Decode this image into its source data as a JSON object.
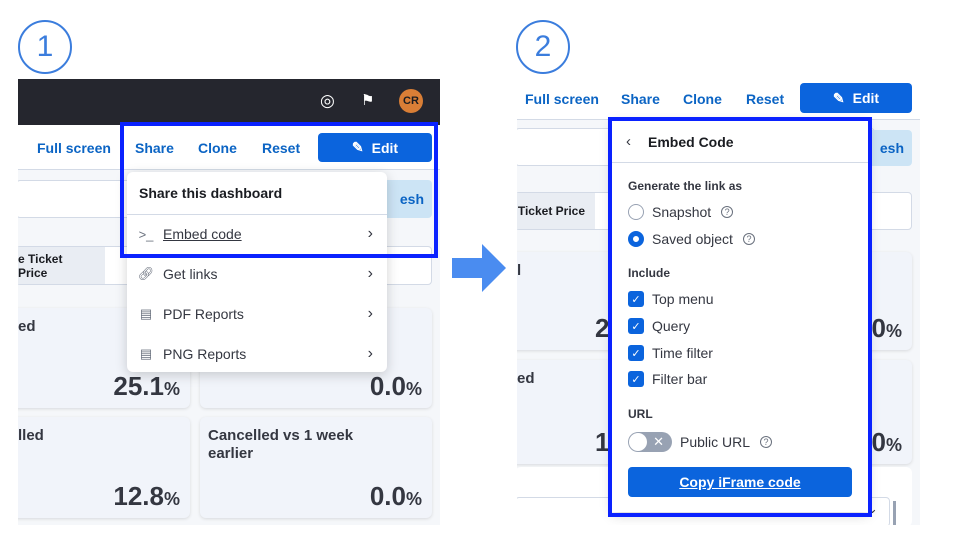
{
  "steps": [
    "1",
    "2"
  ],
  "header": {
    "avatar": "CR",
    "avatar_color": "#d97e36",
    "icons": [
      "help-lifebuoy-icon",
      "news-party-icon"
    ]
  },
  "toolbar": {
    "full_screen": "Full screen",
    "share": "Share",
    "clone": "Clone",
    "reset": "Reset",
    "edit": "Edit"
  },
  "query": {
    "refresh_partial": "esh"
  },
  "filters": {
    "left_pill": "e Ticket Price",
    "right_pill": "Ticket Price"
  },
  "cards_left": [
    {
      "title": "ed",
      "value": "25.1",
      "unit": "%"
    },
    {
      "title": "",
      "value": "0.0",
      "unit": "%"
    },
    {
      "title": "lled",
      "value": "12.8",
      "unit": "%"
    },
    {
      "title": "Cancelled vs 1 week earlier",
      "value": "0.0",
      "unit": "%"
    }
  ],
  "cards_right": [
    {
      "title": "l",
      "value_left": "2",
      "value_right": "0",
      "unit": "%"
    },
    {
      "title": "ed",
      "value_left": "1",
      "value_right": "0",
      "unit": "%"
    }
  ],
  "share_menu": {
    "title": "Share this dashboard",
    "items": [
      {
        "label": "Embed code",
        "icon": "terminal-icon"
      },
      {
        "label": "Get links",
        "icon": "link-icon"
      },
      {
        "label": "PDF Reports",
        "icon": "document-icon"
      },
      {
        "label": "PNG Reports",
        "icon": "document-icon"
      }
    ]
  },
  "embed": {
    "title": "Embed Code",
    "generate_label": "Generate the link as",
    "radio_options": [
      {
        "label": "Snapshot",
        "selected": false
      },
      {
        "label": "Saved object",
        "selected": true
      }
    ],
    "include_label": "Include",
    "checkboxes": [
      {
        "label": "Top menu",
        "checked": true
      },
      {
        "label": "Query",
        "checked": true
      },
      {
        "label": "Time filter",
        "checked": true
      },
      {
        "label": "Filter bar",
        "checked": true
      }
    ],
    "url_label": "URL",
    "public_url": "Public URL",
    "public_url_on": false,
    "copy_button": "Copy iFrame code"
  },
  "colors": {
    "accent": "#0b64dd",
    "highlight": "#0a22ff",
    "step": "#3b7ddd",
    "arrow": "#4a8cf0"
  }
}
